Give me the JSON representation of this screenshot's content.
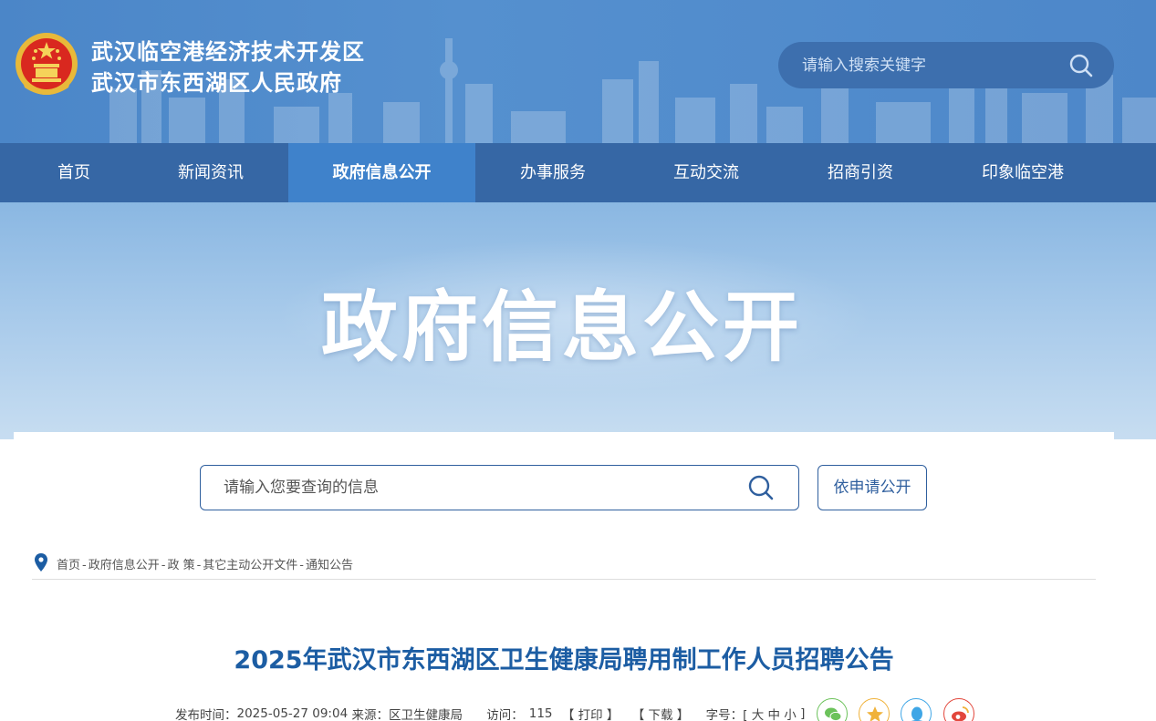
{
  "header": {
    "title_line1": "武汉临空港经济技术开发区",
    "title_line2": "武汉市东西湖区人民政府",
    "search_placeholder": "请输入搜索关键字",
    "emblem_icon": "national-emblem-icon",
    "search_icon": "search-icon"
  },
  "nav": {
    "items": [
      {
        "label": "首页"
      },
      {
        "label": "新闻资讯"
      },
      {
        "label": "政府信息公开",
        "active": true
      },
      {
        "label": "办事服务"
      },
      {
        "label": "互动交流"
      },
      {
        "label": "招商引资"
      },
      {
        "label": "印象临空港"
      }
    ]
  },
  "banner": {
    "title": "政府信息公开"
  },
  "query": {
    "placeholder": "请输入您要查询的信息",
    "apply_label": "依申请公开"
  },
  "breadcrumb": {
    "items": [
      "首页",
      "政府信息公开",
      "政 策",
      "其它主动公开文件",
      "通知公告"
    ],
    "separator": "-"
  },
  "article": {
    "title": "2025年武汉市东西湖区卫生健康局聘用制工作人员招聘公告",
    "publish_label": "发布时间：",
    "publish_time": "2025-05-27 09:04",
    "source_label": "来源：",
    "source": "区卫生健康局",
    "visits_label": "访问：",
    "visits": "115",
    "print_label": "【 打印 】",
    "download_label": "【 下载 】",
    "fontsize_label": "字号：[",
    "font_large": "大",
    "font_medium": "中",
    "font_small": "小",
    "fontsize_close": "]"
  },
  "share": {
    "icons": [
      "wechat-icon",
      "qzone-icon",
      "qq-icon",
      "weibo-icon"
    ]
  },
  "colors": {
    "header_bg": "#4b86c8",
    "nav_bg": "#3667a5",
    "nav_active": "#3f82cb",
    "title_blue": "#1c5da3",
    "border_blue": "#2f5f9e"
  }
}
